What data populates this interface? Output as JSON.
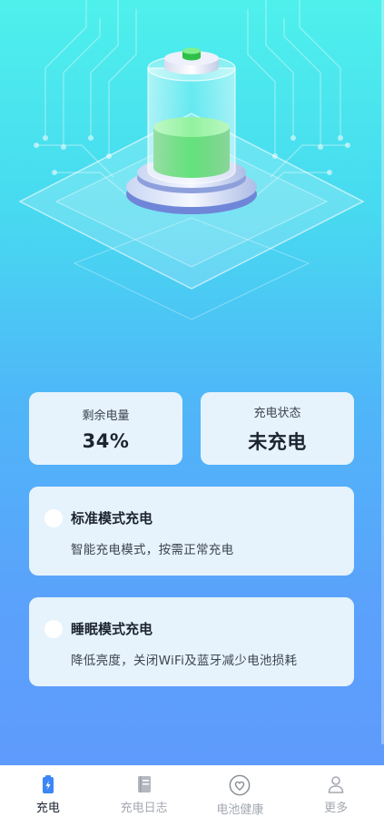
{
  "stats": {
    "remaining_label": "剩余电量",
    "remaining_value": "34%",
    "status_label": "充电状态",
    "status_value": "未充电"
  },
  "modes": [
    {
      "title": "标准模式充电",
      "desc": "智能充电模式，按需正常充电"
    },
    {
      "title": "睡眠模式充电",
      "desc": "降低亮度，关闭WiFi及蓝牙减少电池损耗"
    }
  ],
  "tabs": [
    {
      "label": "充电",
      "icon": "battery-charge-icon",
      "active": true
    },
    {
      "label": "充电日志",
      "icon": "log-book-icon",
      "active": false
    },
    {
      "label": "电池健康",
      "icon": "heart-icon",
      "active": false
    },
    {
      "label": "更多",
      "icon": "user-icon",
      "active": false
    }
  ],
  "colors": {
    "accent_blue": "#3d86f5",
    "battery_green": "#3fd25c",
    "card_bg": "#e6f3fc"
  }
}
